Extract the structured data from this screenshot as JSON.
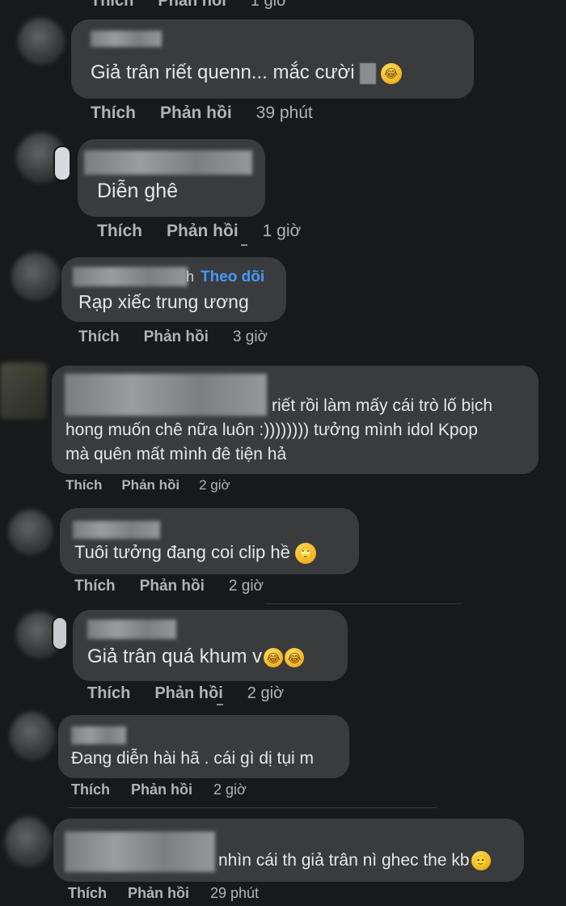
{
  "actions": {
    "like": "Thích",
    "reply": "Phản hồi"
  },
  "follow_label": "Theo dõi",
  "top_partial": {
    "time": "1 giờ"
  },
  "comments": [
    {
      "text": "Giả trân riết quenn... mắc cười",
      "time": "39 phút",
      "icon": "rofl-emoji-icon"
    },
    {
      "text": "Diễn ghê",
      "time": "1 giờ"
    },
    {
      "text": "Rạp xiếc trung ương",
      "time": "3 giờ",
      "name_suffix": "h"
    },
    {
      "line1": "riết rồi làm mấy cái trò lố bịch",
      "line2": "hong muốn chê nữa luôn :)))))))) tưởng mình idol Kpop",
      "line3": "mà quên mất mình đê tiện hả",
      "time": "2 giờ"
    },
    {
      "text": "Tuôi tưởng đang coi clip hề",
      "time": "2 giờ",
      "icon": "rolling-eyes-emoji-icon"
    },
    {
      "text": "Giả trân quá khum v",
      "time": "2 giờ",
      "icon": "rofl-emoji-icon"
    },
    {
      "text": "Đang diễn hài hã . cái gì dị tụi m",
      "time": "2 giờ"
    },
    {
      "text": "nhìn cái th giả trân nì ghec the kb",
      "time": "29 phút",
      "icon": "smile-emoji-icon"
    }
  ]
}
